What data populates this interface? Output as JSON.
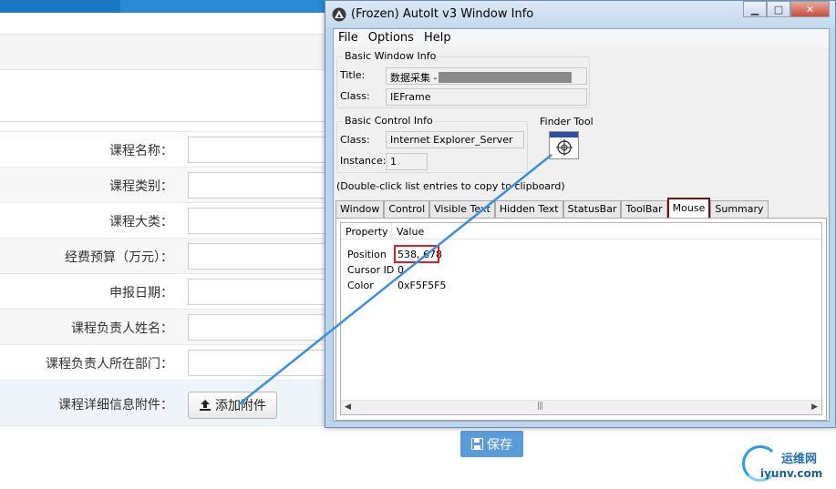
{
  "form": {
    "rows": [
      {
        "label": "课程名称："
      },
      {
        "label": "课程类别："
      },
      {
        "label": "课程大类："
      },
      {
        "label": "经费预算（万元）："
      },
      {
        "label": "申报日期："
      },
      {
        "label": "课程负责人姓名："
      },
      {
        "label": "课程负责人所在部门："
      }
    ],
    "attach_label": "课程详细信息附件：",
    "attach_button": "添加附件",
    "save_button": "保存"
  },
  "autoit": {
    "title": "(Frozen) AutoIt v3 Window Info",
    "menu": [
      "File",
      "Options",
      "Help"
    ],
    "basic_window_info": {
      "heading": "Basic Window Info",
      "title_label": "Title:",
      "title_value": "数据采集 -",
      "class_label": "Class:",
      "class_value": "IEFrame"
    },
    "basic_control_info": {
      "heading": "Basic Control Info",
      "class_label": "Class:",
      "class_value": "Internet Explorer_Server",
      "instance_label": "Instance:",
      "instance_value": "1"
    },
    "finder_tool": "Finder Tool",
    "hint": "(Double-click list entries to copy to clipboard)",
    "tabs": [
      "Window",
      "Control",
      "Visible Text",
      "Hidden Text",
      "StatusBar",
      "ToolBar",
      "Mouse",
      "Summary"
    ],
    "active_tab": "Mouse",
    "columns": [
      "Property",
      "Value"
    ],
    "rows": [
      {
        "property": "Position",
        "value": "538, 678"
      },
      {
        "property": "Cursor ID",
        "value": "0"
      },
      {
        "property": "Color",
        "value": "0xF5F5F5"
      }
    ],
    "scroll_thumb": "|||"
  },
  "watermark": {
    "top": "运维网",
    "bottom": "iyunv.com"
  },
  "colors": {
    "accent_blue": "#1a78c2",
    "save_button": "#5b9bd9",
    "highlight_red": "#e02020",
    "active_tab_border": "#7a0f16"
  }
}
